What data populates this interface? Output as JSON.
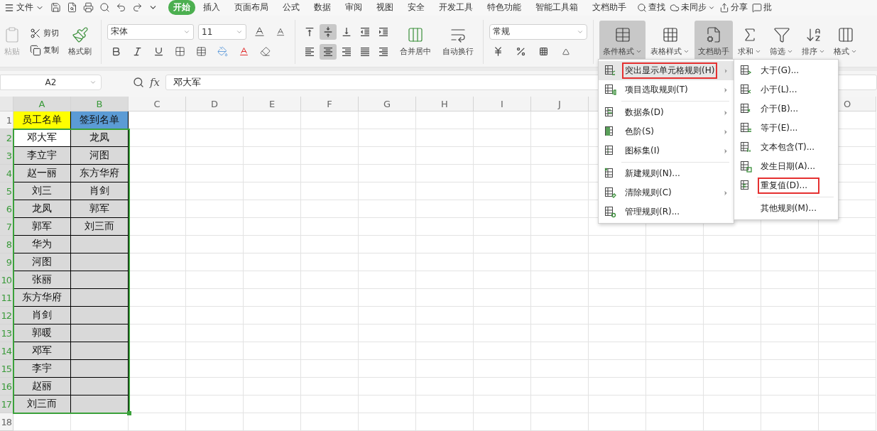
{
  "quick_bar": {
    "menu_label": "文件"
  },
  "tabs": [
    {
      "label": "开始",
      "selected": true
    },
    {
      "label": "插入",
      "selected": false
    },
    {
      "label": "页面布局",
      "selected": false
    },
    {
      "label": "公式",
      "selected": false
    },
    {
      "label": "数据",
      "selected": false
    },
    {
      "label": "审阅",
      "selected": false
    },
    {
      "label": "视图",
      "selected": false
    },
    {
      "label": "安全",
      "selected": false
    },
    {
      "label": "开发工具",
      "selected": false
    },
    {
      "label": "特色功能",
      "selected": false
    },
    {
      "label": "智能工具箱",
      "selected": false
    },
    {
      "label": "文档助手",
      "selected": false
    }
  ],
  "top_actions": [
    {
      "label": "查找",
      "kind": "search"
    },
    {
      "label": "未同步",
      "kind": "cloud"
    },
    {
      "label": "分享",
      "kind": "share"
    },
    {
      "label": "批",
      "kind": "comment"
    }
  ],
  "clipboard": {
    "paste": {
      "label": "粘贴",
      "disabled": true
    },
    "cut": "剪切",
    "copy": "复制",
    "format_painter": "格式刷"
  },
  "font": {
    "name": "宋体",
    "size": "11"
  },
  "align_buttons": [
    {
      "kind": "top",
      "pressed": false
    },
    {
      "kind": "middle",
      "pressed": true
    },
    {
      "kind": "bottom",
      "pressed": false
    },
    {
      "kind": "outdent",
      "pressed": false
    },
    {
      "kind": "indent",
      "pressed": false
    },
    {
      "kind": "left",
      "pressed": false
    },
    {
      "kind": "center",
      "pressed": true
    },
    {
      "kind": "right",
      "pressed": false
    },
    {
      "kind": "justify",
      "pressed": false
    },
    {
      "kind": "distributed",
      "pressed": false
    }
  ],
  "alignment": {
    "merge": "合并居中",
    "wrap": "自动换行"
  },
  "number": {
    "format": "常规"
  },
  "tools": [
    {
      "label": "条件格式",
      "kind": "conditional",
      "pressed": true,
      "dropdown": true
    },
    {
      "label": "表格样式",
      "kind": "style",
      "pressed": false,
      "dropdown": true
    },
    {
      "label": "文档助手",
      "kind": "assistant",
      "pressed": true,
      "dropdown": false
    },
    {
      "label": "求和",
      "kind": "sum",
      "pressed": false,
      "dropdown": true
    },
    {
      "label": "筛选",
      "kind": "filter",
      "pressed": false,
      "dropdown": true
    },
    {
      "label": "排序",
      "kind": "sort",
      "pressed": false,
      "dropdown": true
    },
    {
      "label": "格式",
      "kind": "format",
      "pressed": false,
      "dropdown": true
    }
  ],
  "formula_bar": {
    "cell": "A2",
    "fx_label": "fx",
    "value": "邓大军"
  },
  "sheet": {
    "columns": [
      "A",
      "B",
      "C",
      "D",
      "E",
      "F",
      "G",
      "H",
      "I",
      "J"
    ],
    "right_columns": [
      "O"
    ],
    "rows": [
      {
        "number": "1",
        "selected": false,
        "cells": [
          {
            "text": "员工名单",
            "color": "#ffff00"
          },
          {
            "text": "签到名单",
            "color": "#5b9bd5"
          }
        ]
      },
      {
        "number": "2",
        "selected": true,
        "cells": [
          {
            "text": "邓大军",
            "active": true
          },
          {
            "text": "龙凤",
            "active": false
          }
        ]
      },
      {
        "number": "3",
        "selected": true,
        "cells": [
          {
            "text": "李立宇",
            "active": false
          },
          {
            "text": "河图",
            "active": false
          }
        ]
      },
      {
        "number": "4",
        "selected": true,
        "cells": [
          {
            "text": "赵一丽",
            "active": false
          },
          {
            "text": "东方华府",
            "active": false
          }
        ]
      },
      {
        "number": "5",
        "selected": true,
        "cells": [
          {
            "text": "刘三",
            "active": false
          },
          {
            "text": "肖剑",
            "active": false
          }
        ]
      },
      {
        "number": "6",
        "selected": true,
        "cells": [
          {
            "text": "龙凤",
            "active": false
          },
          {
            "text": "郭军",
            "active": false
          }
        ]
      },
      {
        "number": "7",
        "selected": true,
        "cells": [
          {
            "text": "郭军",
            "active": false
          },
          {
            "text": "刘三而",
            "active": false
          }
        ]
      },
      {
        "number": "8",
        "selected": true,
        "cells": [
          {
            "text": "华为",
            "active": false
          },
          {
            "active": false
          }
        ]
      },
      {
        "number": "9",
        "selected": true,
        "cells": [
          {
            "text": "河图",
            "active": false
          },
          {
            "active": false
          }
        ]
      },
      {
        "number": "10",
        "selected": true,
        "cells": [
          {
            "text": "张丽",
            "active": false
          },
          {
            "active": false
          }
        ]
      },
      {
        "number": "11",
        "selected": true,
        "cells": [
          {
            "text": "东方华府",
            "active": false
          },
          {
            "active": false
          }
        ]
      },
      {
        "number": "12",
        "selected": true,
        "cells": [
          {
            "text": "肖剑",
            "active": false
          },
          {
            "active": false
          }
        ]
      },
      {
        "number": "13",
        "selected": true,
        "cells": [
          {
            "text": "郭暖",
            "active": false
          },
          {
            "active": false
          }
        ]
      },
      {
        "number": "14",
        "selected": true,
        "cells": [
          {
            "text": "邓军",
            "active": false
          },
          {
            "active": false
          }
        ]
      },
      {
        "number": "15",
        "selected": true,
        "cells": [
          {
            "text": "李宇",
            "active": false
          },
          {
            "active": false
          }
        ]
      },
      {
        "number": "16",
        "selected": true,
        "cells": [
          {
            "text": "赵丽",
            "active": false
          },
          {
            "active": false
          }
        ]
      },
      {
        "number": "17",
        "selected": true,
        "cells": [
          {
            "text": "刘三而",
            "active": false
          },
          {
            "active": false
          }
        ]
      },
      {
        "number": "18",
        "selected": false,
        "cells": []
      }
    ]
  },
  "menu": {
    "groups": [
      [
        {
          "label": "突出显示单元格规则(H)",
          "kind": "highlight",
          "submenu": true,
          "selected": true,
          "marked": true
        },
        {
          "label": "项目选取规则(T)",
          "kind": "top10",
          "submenu": true,
          "selected": false,
          "marked": false
        }
      ],
      [
        {
          "label": "数据条(D)",
          "kind": "databar",
          "submenu": true,
          "selected": false,
          "marked": false
        },
        {
          "label": "色阶(S)",
          "kind": "scale",
          "submenu": true,
          "selected": false,
          "marked": false
        },
        {
          "label": "图标集(I)",
          "kind": "iconset",
          "submenu": true,
          "selected": false,
          "marked": false
        }
      ],
      [
        {
          "label": "新建规则(N)...",
          "kind": "new",
          "submenu": false,
          "selected": false,
          "marked": false
        },
        {
          "label": "清除规则(C)",
          "kind": "clear",
          "submenu": true,
          "selected": false,
          "marked": false
        },
        {
          "label": "管理规则(R)...",
          "kind": "manage",
          "submenu": false,
          "selected": false,
          "marked": false
        }
      ]
    ]
  },
  "submenu": {
    "groups": [
      [
        {
          "label": "大于(G)...",
          "kind": "greater",
          "marked": false
        },
        {
          "label": "小于(L)...",
          "kind": "less",
          "marked": false
        },
        {
          "label": "介于(B)...",
          "kind": "between",
          "marked": false
        },
        {
          "label": "等于(E)...",
          "kind": "equal",
          "marked": false
        },
        {
          "label": "文本包含(T)...",
          "kind": "text",
          "marked": false
        },
        {
          "label": "发生日期(A)...",
          "kind": "date",
          "marked": false
        },
        {
          "label": "重复值(D)...",
          "kind": "duplicate",
          "marked": true
        }
      ],
      [
        {
          "label": "其他规则(M)...",
          "kind": "other",
          "marked": false
        }
      ]
    ]
  }
}
